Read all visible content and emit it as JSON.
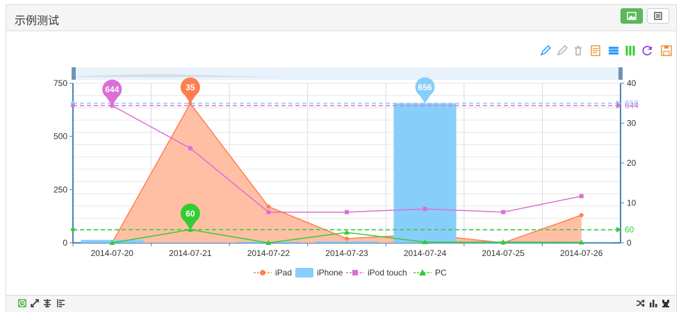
{
  "panel": {
    "title": "示例测试"
  },
  "toolbox": {
    "icons": [
      "mark-pen-icon",
      "mark-undo-icon",
      "mark-clear-icon",
      "data-view-icon",
      "line-chart-icon",
      "bar-chart-icon",
      "restore-icon",
      "save-image-icon"
    ]
  },
  "footer": {
    "left_icons": [
      "clock-icon",
      "expand-icon",
      "align-center-icon",
      "align-left-icon"
    ],
    "right_icons": [
      "shuffle-icon",
      "bar-chart-icon",
      "pause-icon"
    ]
  },
  "chart_data": {
    "type": "line",
    "categories": [
      "2014-07-20",
      "2014-07-21",
      "2014-07-22",
      "2014-07-23",
      "2014-07-24",
      "2014-07-25",
      "2014-07-26"
    ],
    "left_axis": {
      "ticks": [
        0,
        250,
        500,
        750
      ],
      "range": [
        0,
        750
      ]
    },
    "right_axis": {
      "ticks": [
        0,
        10,
        20,
        30,
        40
      ],
      "range": [
        0,
        40
      ]
    },
    "series": [
      {
        "name": "iPad",
        "type": "area",
        "axis": "left",
        "color": "#ff7f50",
        "fill": "#ffbfa4",
        "values": [
          0,
          655,
          170,
          20,
          40,
          0,
          130
        ],
        "max_pin": "35"
      },
      {
        "name": "iPhone",
        "type": "bar",
        "axis": "left",
        "color": "#87cefa",
        "values": [
          14,
          1,
          5,
          7,
          656,
          6,
          1
        ],
        "max_pin": "656",
        "max_line_label": "656"
      },
      {
        "name": "iPod touch",
        "type": "line",
        "axis": "right",
        "color": "#da70d6",
        "values": [
          34.4,
          23.7,
          7.7,
          7.7,
          8.5,
          7.7,
          11.7
        ],
        "max_pin": "644",
        "max_line_label": "644"
      },
      {
        "name": "PC",
        "type": "line",
        "axis": "right",
        "color": "#32cd32",
        "values": [
          0,
          3.3,
          0,
          2.6,
          0.2,
          0.2,
          0.1
        ],
        "max_pin": "60",
        "avg_line_label": "60"
      }
    ],
    "legend": {
      "position": "bottom"
    },
    "datazoom": true
  }
}
